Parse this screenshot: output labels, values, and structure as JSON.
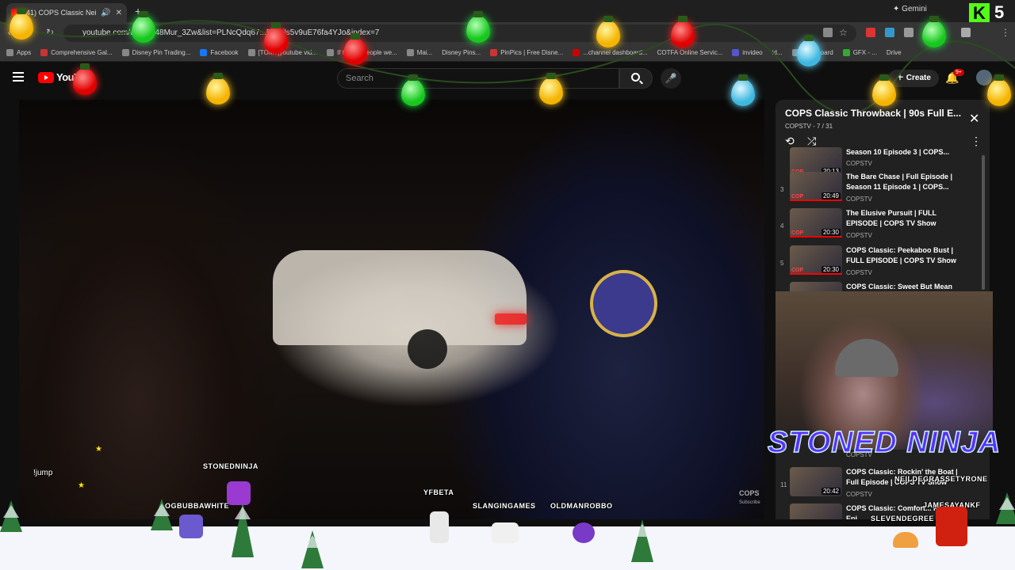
{
  "browser": {
    "tab_title": "(41) COPS Classic Neighbo...",
    "gemini_label": "Gemini",
    "url": "youtube.com/w...=qx48Mur_3Zw&list=PLNcQdq67...FkWils5v9uE76fa4YJo&index=7",
    "bookmarks": [
      "Apps",
      "Comprehensive Gal...",
      "Disney Pin Trading...",
      "Facebook",
      "[TOMT]youtube vid...",
      "If todays people we...",
      "Mai...",
      "Disney Pins...",
      "PinPics | Free Disne...",
      "...channel dashboard...",
      "COTFA Online Servic...",
      "invideo",
      "id...",
      "Dashboard",
      "GFX - ...",
      "Drive"
    ],
    "kick_letter": "K",
    "kick_number": "5"
  },
  "youtube": {
    "logo_text": "YouT",
    "search_placeholder": "Search",
    "create_label": "Create",
    "notif_count": "9+"
  },
  "video": {
    "watermark": "COPS",
    "subscribe": "Subscribe"
  },
  "playlist": {
    "title": "COPS Classic Throwback | 90s Full E...",
    "subtitle": "COPSTV - 7 / 31",
    "items": [
      {
        "index": "",
        "title": "Season 10 Episode 3 | COPS...",
        "channel": "COPSTV",
        "duration": "20:13"
      },
      {
        "index": "3",
        "title": "The Bare Chase | Full Episode | Season 11 Episode 1 | COPS...",
        "channel": "COPSTV",
        "duration": "20:49"
      },
      {
        "index": "4",
        "title": "The Elusive Pursuit | FULL EPISODE | COPS TV Show",
        "channel": "COPSTV",
        "duration": "20:30"
      },
      {
        "index": "5",
        "title": "COPS Classic: Peekaboo Bust | FULL EPISODE | COPS TV Show",
        "channel": "COPSTV",
        "duration": "20:30"
      },
      {
        "index": "",
        "title": "COPS Classic: Sweet But Mean",
        "channel": "",
        "duration": ""
      }
    ],
    "lower_items": [
      {
        "index": "",
        "title": "",
        "channel": "COPSTV",
        "duration": ""
      },
      {
        "index": "11",
        "title": "COPS Classic: Rockin' the Boat | Full Episode | COPS TV Show",
        "channel": "COPSTV",
        "duration": "20:42"
      },
      {
        "index": "",
        "title": "COPS Classic: Comfort... Full Epi...",
        "channel": "",
        "duration": ""
      }
    ]
  },
  "overlay": {
    "streamer_name": "STONED NINJA",
    "jump_cmd": "!jump",
    "chatters": [
      "STONEDNINJA",
      "OGBUBBAWHITE",
      "YFBETA",
      "SLANGINGAMES",
      "OLDMANROBBO",
      "NEILDEGRASSETYRONE",
      "JAMESAYANKF",
      "SLEVENDEGREE"
    ]
  }
}
